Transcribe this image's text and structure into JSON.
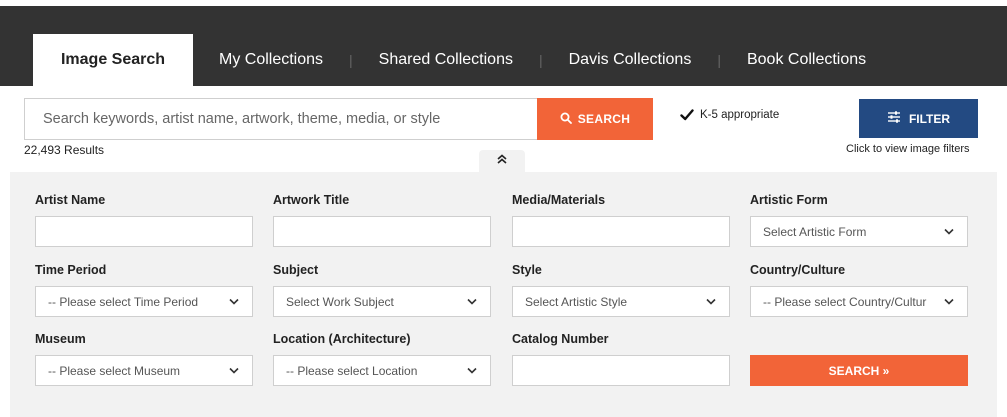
{
  "nav": {
    "tabs": [
      {
        "label": "Image Search",
        "active": true
      },
      {
        "label": "My Collections"
      },
      {
        "label": "Shared Collections"
      },
      {
        "label": "Davis Collections"
      },
      {
        "label": "Book Collections"
      }
    ]
  },
  "search": {
    "placeholder": "Search keywords, artist name, artwork, theme, media, or style",
    "button_label": "SEARCH",
    "k5_label": "K-5 appropriate",
    "k5_checked": true,
    "filter_label": "FILTER",
    "filter_hint": "Click to view image filters",
    "results": "22,493 Results"
  },
  "filters": {
    "artist_name": {
      "label": "Artist Name",
      "value": ""
    },
    "artwork_title": {
      "label": "Artwork Title",
      "value": ""
    },
    "media_materials": {
      "label": "Media/Materials",
      "value": ""
    },
    "artistic_form": {
      "label": "Artistic Form",
      "selected": "Select Artistic Form"
    },
    "time_period": {
      "label": "Time Period",
      "selected": "-- Please select Time Period"
    },
    "subject": {
      "label": "Subject",
      "selected": "Select Work Subject"
    },
    "style": {
      "label": "Style",
      "selected": "Select Artistic Style"
    },
    "country_culture": {
      "label": "Country/Culture",
      "selected": "-- Please select Country/Cultur"
    },
    "museum": {
      "label": "Museum",
      "selected": "-- Please select Museum"
    },
    "location": {
      "label": "Location (Architecture)",
      "selected": "-- Please select Location"
    },
    "catalog_number": {
      "label": "Catalog Number",
      "value": ""
    },
    "search_label": "SEARCH »"
  },
  "colors": {
    "navbar": "#333333",
    "accent_orange": "#f26438",
    "filter_blue": "#234a82",
    "panel_bg": "#f2f2f2"
  },
  "icons": {
    "search": "magnifier-icon",
    "filter": "sliders-icon",
    "collapse": "double-chevron-up-icon",
    "checkbox": "checkmark-icon",
    "select": "chevron-down-icon"
  }
}
